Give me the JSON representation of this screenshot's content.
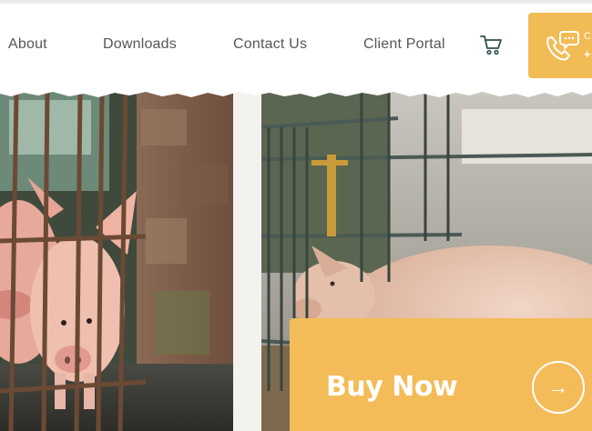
{
  "nav": {
    "items": [
      "About",
      "Downloads",
      "Contact Us",
      "Client Portal"
    ]
  },
  "icons": {
    "cart": "shopping-cart-icon",
    "call": "phone-chat-icon",
    "arrow": "arrow-right-icon"
  },
  "call_box": {
    "line1": "C",
    "line2": "+"
  },
  "cta": {
    "label": "Buy Now"
  },
  "colors": {
    "accent": "#f4bc58",
    "nav_text": "#555555",
    "icon": "#2f4f4f"
  }
}
